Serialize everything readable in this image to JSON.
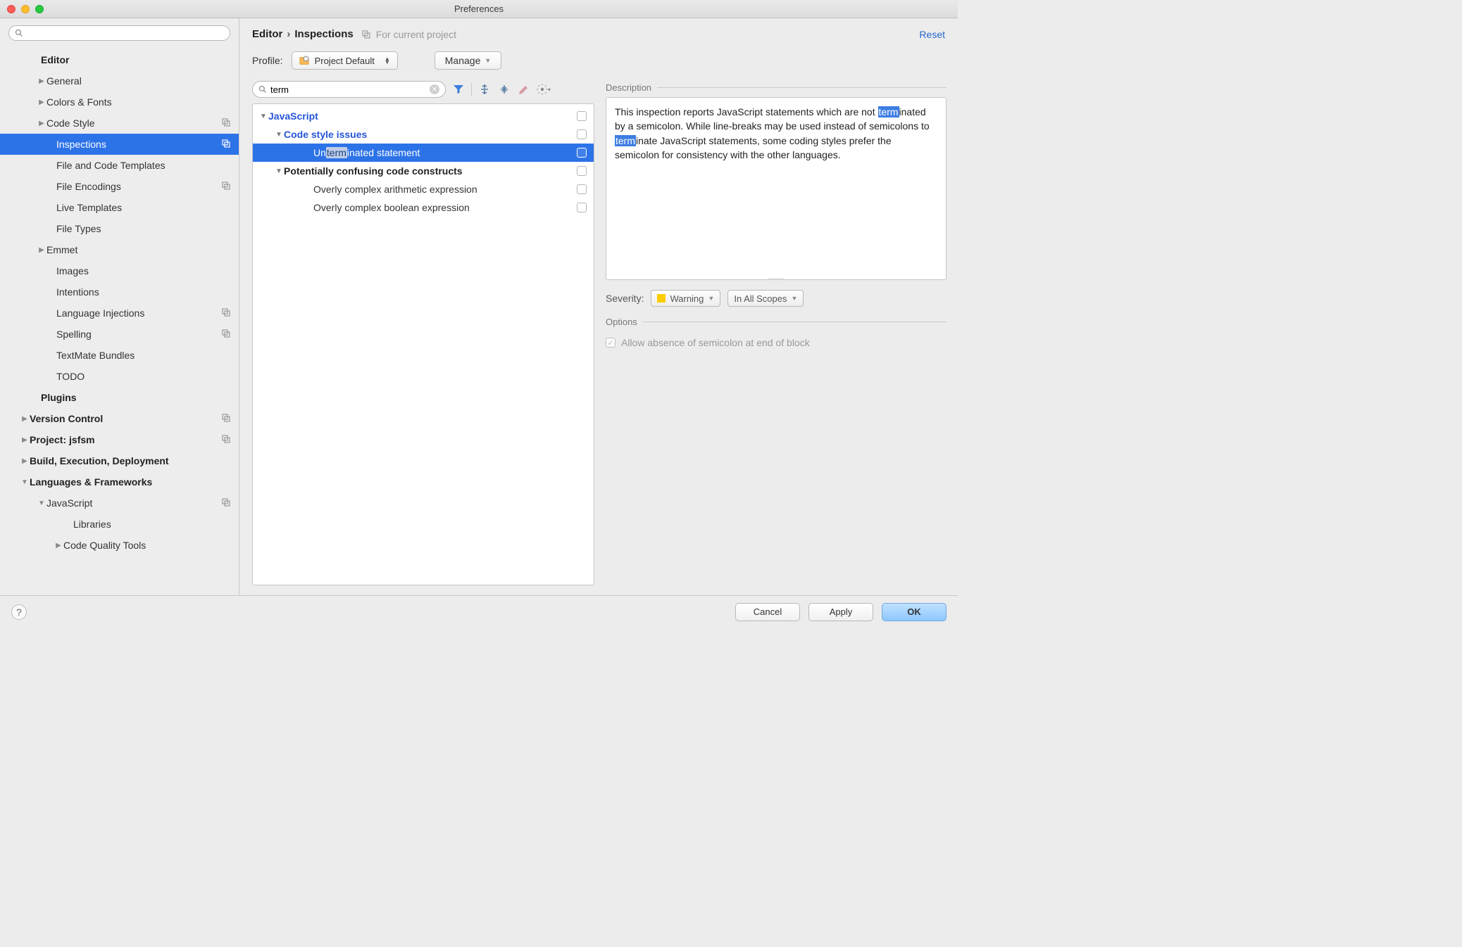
{
  "window": {
    "title": "Preferences"
  },
  "sidebar": {
    "search_placeholder": "",
    "items": [
      {
        "label": "Editor",
        "bold": true,
        "arrow": "",
        "indent": 44
      },
      {
        "label": "General",
        "arrow": "▶",
        "indent": 52
      },
      {
        "label": "Colors & Fonts",
        "arrow": "▶",
        "indent": 52
      },
      {
        "label": "Code Style",
        "arrow": "▶",
        "indent": 52,
        "badge": "copy"
      },
      {
        "label": "Inspections",
        "arrow": "",
        "indent": 66,
        "selected": true,
        "badge": "copy"
      },
      {
        "label": "File and Code Templates",
        "arrow": "",
        "indent": 66
      },
      {
        "label": "File Encodings",
        "arrow": "",
        "indent": 66,
        "badge": "copy"
      },
      {
        "label": "Live Templates",
        "arrow": "",
        "indent": 66
      },
      {
        "label": "File Types",
        "arrow": "",
        "indent": 66
      },
      {
        "label": "Emmet",
        "arrow": "▶",
        "indent": 52
      },
      {
        "label": "Images",
        "arrow": "",
        "indent": 66
      },
      {
        "label": "Intentions",
        "arrow": "",
        "indent": 66
      },
      {
        "label": "Language Injections",
        "arrow": "",
        "indent": 66,
        "badge": "copy"
      },
      {
        "label": "Spelling",
        "arrow": "",
        "indent": 66,
        "badge": "copy"
      },
      {
        "label": "TextMate Bundles",
        "arrow": "",
        "indent": 66
      },
      {
        "label": "TODO",
        "arrow": "",
        "indent": 66
      },
      {
        "label": "Plugins",
        "bold": true,
        "arrow": "",
        "indent": 44
      },
      {
        "label": "Version Control",
        "bold": true,
        "arrow": "▶",
        "indent": 28,
        "badge": "copy"
      },
      {
        "label": "Project: jsfsm",
        "bold": true,
        "arrow": "▶",
        "indent": 28,
        "badge": "copy"
      },
      {
        "label": "Build, Execution, Deployment",
        "bold": true,
        "arrow": "▶",
        "indent": 28
      },
      {
        "label": "Languages & Frameworks",
        "bold": true,
        "arrow": "▼",
        "indent": 28
      },
      {
        "label": "JavaScript",
        "arrow": "▼",
        "indent": 52,
        "badge": "copy"
      },
      {
        "label": "Libraries",
        "arrow": "",
        "indent": 90
      },
      {
        "label": "Code Quality Tools",
        "arrow": "▶",
        "indent": 76
      }
    ]
  },
  "header": {
    "crumb1": "Editor",
    "crumb2": "Inspections",
    "sub": "For current project",
    "reset": "Reset"
  },
  "profile": {
    "label": "Profile:",
    "value": "Project Default",
    "manage": "Manage"
  },
  "inspections": {
    "search_value": "term",
    "tree": [
      {
        "label": "JavaScript",
        "arrow": "▼",
        "indent": 8,
        "style": "blue"
      },
      {
        "label": "Code style issues",
        "arrow": "▼",
        "indent": 30,
        "style": "blue"
      },
      {
        "pre": "Un",
        "hl": "term",
        "post": "inated statement",
        "arrow": "",
        "indent": 72,
        "selected": true
      },
      {
        "label": "Potentially confusing code constructs",
        "arrow": "▼",
        "indent": 30,
        "style": "groupbold"
      },
      {
        "label": "Overly complex arithmetic expression",
        "arrow": "",
        "indent": 72
      },
      {
        "label": "Overly complex boolean expression",
        "arrow": "",
        "indent": 72
      }
    ]
  },
  "details": {
    "desc_label": "Description",
    "desc_p1": "This inspection reports JavaScript statements which are not ",
    "desc_hl1": "term",
    "desc_p2": "inated by a semicolon. While line-breaks may be used instead of semicolons to ",
    "desc_hl2": "term",
    "desc_p3": "inate JavaScript statements, some coding styles prefer the semicolon for consistency with the other languages.",
    "severity_label": "Severity:",
    "severity_value": "Warning",
    "scope_value": "In All Scopes",
    "options_label": "Options",
    "option1": "Allow absence of semicolon at end of block"
  },
  "buttons": {
    "cancel": "Cancel",
    "apply": "Apply",
    "ok": "OK"
  }
}
